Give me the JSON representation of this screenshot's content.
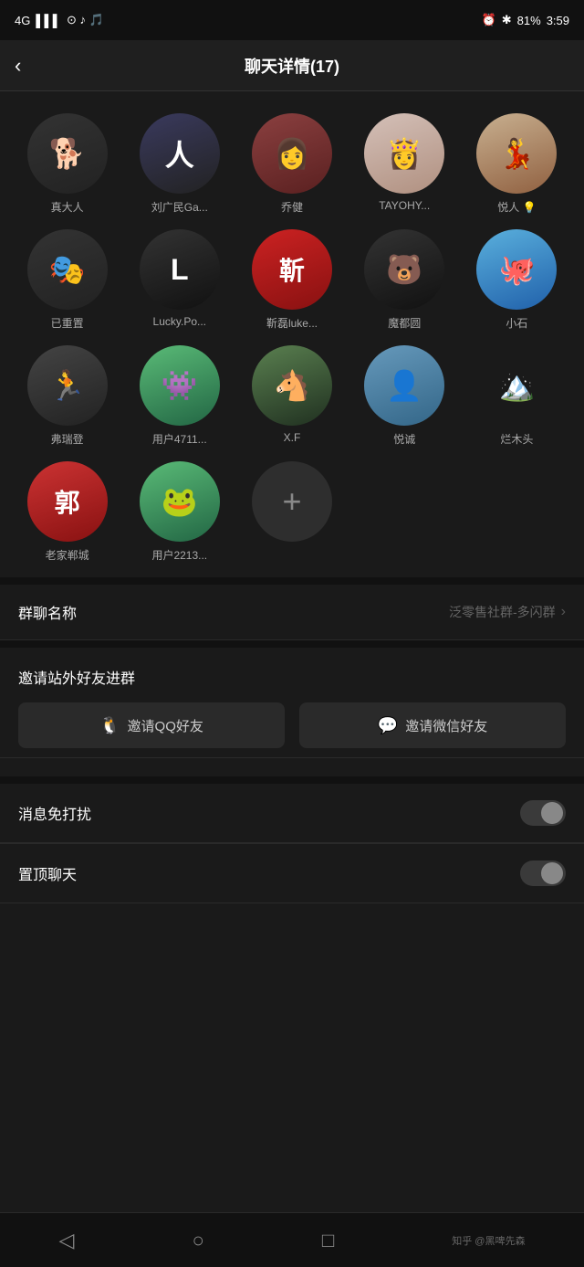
{
  "statusBar": {
    "signal": "4G",
    "time": "3:59",
    "battery": "81%"
  },
  "header": {
    "title": "聊天详情(17)",
    "backLabel": "‹"
  },
  "members": [
    {
      "name": "真大人",
      "avatarClass": "av-dog",
      "emoji": "🐕",
      "initials": ""
    },
    {
      "name": "刘广民Ga...",
      "avatarClass": "av-man",
      "emoji": "",
      "initials": "人"
    },
    {
      "name": "乔健",
      "avatarClass": "av-girl",
      "emoji": "",
      "initials": ""
    },
    {
      "name": "TAYOHY...",
      "avatarClass": "av-pink",
      "emoji": "",
      "initials": ""
    },
    {
      "name": "悦人 💡",
      "avatarClass": "av-vintage",
      "emoji": "",
      "initials": ""
    },
    {
      "name": "已重置",
      "avatarClass": "av-tiktok",
      "emoji": "",
      "initials": ""
    },
    {
      "name": "Lucky.Po...",
      "avatarClass": "av-lucky",
      "emoji": "",
      "initials": ""
    },
    {
      "name": "靳磊luke...",
      "avatarClass": "av-red",
      "emoji": "",
      "initials": "靳"
    },
    {
      "name": "魔都圆",
      "avatarClass": "av-bear",
      "emoji": "",
      "initials": ""
    },
    {
      "name": "小石",
      "avatarClass": "av-blue",
      "emoji": "",
      "initials": ""
    },
    {
      "name": "弗瑞登",
      "avatarClass": "av-run",
      "emoji": "",
      "initials": ""
    },
    {
      "name": "用户4711...",
      "avatarClass": "av-green",
      "emoji": "",
      "initials": ""
    },
    {
      "name": "X.F",
      "avatarClass": "av-horse",
      "emoji": "",
      "initials": ""
    },
    {
      "name": "悦诚",
      "avatarClass": "av-person",
      "emoji": "",
      "initials": ""
    },
    {
      "name": "烂木头",
      "avatarClass": "av-beach",
      "emoji": "",
      "initials": ""
    },
    {
      "name": "老家郸城",
      "avatarClass": "av-郭",
      "emoji": "",
      "initials": "郭"
    },
    {
      "name": "用户2213...",
      "avatarClass": "av-frog",
      "emoji": "",
      "initials": ""
    }
  ],
  "groupName": {
    "label": "群聊名称",
    "value": "泛零售社群-多闪群"
  },
  "invite": {
    "label": "邀请站外好友进群",
    "qqButton": "邀请QQ好友",
    "wechatButton": "邀请微信好友"
  },
  "settings": [
    {
      "label": "消息免打扰",
      "type": "toggle"
    },
    {
      "label": "置顶聊天",
      "type": "toggle"
    }
  ],
  "bottomNav": {
    "back": "◁",
    "home": "○",
    "square": "□",
    "zhihu": "知乎 @黑啤先森"
  }
}
